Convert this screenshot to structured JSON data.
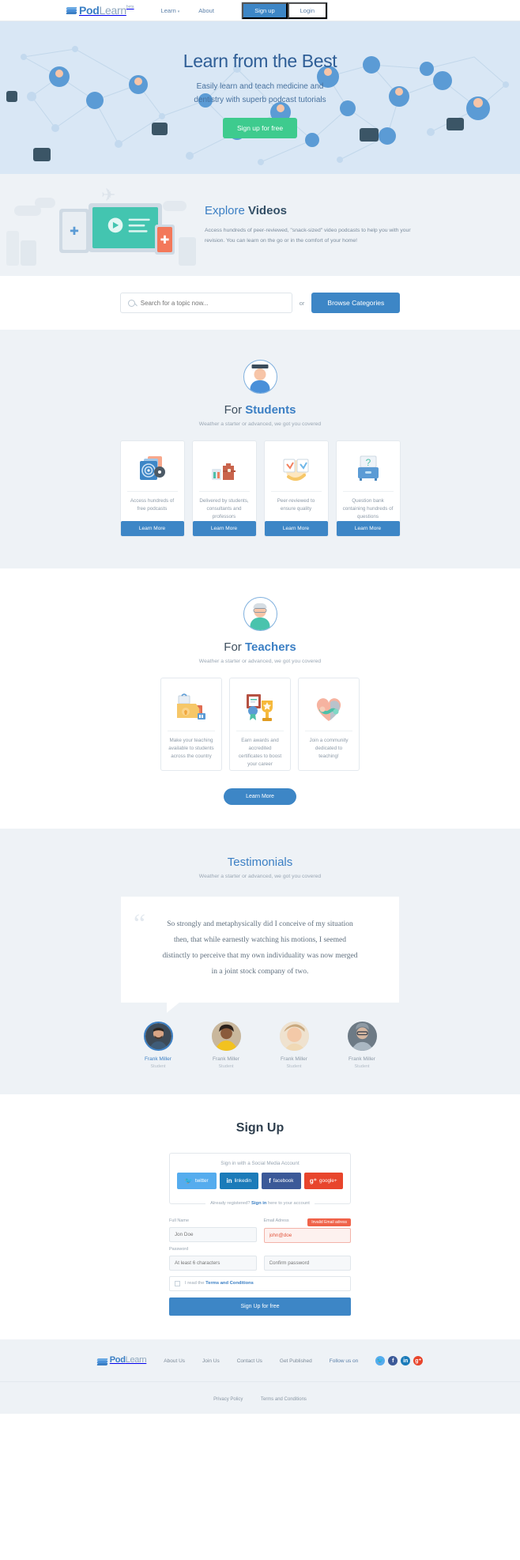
{
  "nav": {
    "brand": {
      "pod": "Pod",
      "learn": "Learn",
      "beta": "beta",
      "icon": "books-stack-icon"
    },
    "links": [
      {
        "label": "Learn",
        "has_caret": true
      },
      {
        "label": "About",
        "has_caret": false
      }
    ],
    "signup_label": "Sign up",
    "login_label": "Login"
  },
  "hero": {
    "title": "Learn from the Best",
    "subtitle_line1": "Easily learn and teach medicine and",
    "subtitle_line2": "dentistry with superb podcast tutorials",
    "cta_label": "Sign up for free",
    "cta_color": "#3ecb8e",
    "bg_color": "#d9e7f5"
  },
  "explore": {
    "heading_light": "Explore ",
    "heading_bold": "Videos",
    "paragraph": "Access hundreds of peer-reviewed, \"snack-sized\" video podcasts to help you with your revision. You can learn on the go or in the comfort of your home!",
    "bg_color": "#eef2f6"
  },
  "search": {
    "placeholder": "Search for a topic now...",
    "value": "",
    "icon": "search-icon",
    "or_label": "or",
    "browse_label": "Browse Categories"
  },
  "students": {
    "avatar_icon": "graduate-student-avatar",
    "heading_light": "For ",
    "heading_bold": "Students",
    "subtitle": "Weather a starter or advanced, we got you covered",
    "cards": [
      {
        "icon": "podcast-folder-icon",
        "text": "Access hundreds of free podcasts",
        "button": "Learn More"
      },
      {
        "icon": "briefcase-icon",
        "text": "Delivered by students, consultants and professors",
        "button": "Learn More"
      },
      {
        "icon": "peer-review-icon",
        "text": "Peer-reviewed to ensure quality",
        "button": "Learn More"
      },
      {
        "icon": "question-bank-icon",
        "text": "Question bank containing hundreds of questions",
        "button": "Learn More"
      }
    ]
  },
  "teachers": {
    "avatar_icon": "professor-avatar",
    "heading_light": "For ",
    "heading_bold": "Teachers",
    "subtitle": "Weather a starter or advanced, we got you covered",
    "cards": [
      {
        "icon": "teaching-materials-icon",
        "text": "Make your teaching available to students across the country"
      },
      {
        "icon": "award-trophy-icon",
        "text": "Earn awards and accredited certificates to boost your career"
      },
      {
        "icon": "community-heart-icon",
        "text": "Join a community dedicated to teaching!"
      }
    ],
    "cta_label": "Learn More"
  },
  "testimonials": {
    "heading": "Testimonials",
    "subtitle": "Weather a starter or advanced, we got you covered",
    "quote_mark": "“",
    "quote_lines": [
      "So strongly and metaphysically did I conceive of my situation",
      "then, that while earnestly watching his motions, I seemed",
      "distinctly to perceive that my own individuality was now merged",
      "in a joint stock company of two."
    ],
    "people": [
      {
        "name": "Frank Miller",
        "role": "Student",
        "active": true
      },
      {
        "name": "Frank Miller",
        "role": "Student",
        "active": false
      },
      {
        "name": "Frank Miller",
        "role": "Student",
        "active": false
      },
      {
        "name": "Frank Miller",
        "role": "Student",
        "active": false
      }
    ]
  },
  "signup": {
    "heading": "Sign Up",
    "social_label": "Sign in with a Social Media Account",
    "social_buttons": [
      {
        "label": "twitter",
        "glyph": "ᴠ",
        "color": "#55acee",
        "icon": "twitter-icon"
      },
      {
        "label": "linkedin",
        "glyph": "in",
        "color": "#1b7bb9",
        "icon": "linkedin-icon"
      },
      {
        "label": "facebook",
        "glyph": "f",
        "color": "#3b5998",
        "icon": "facebook-icon"
      },
      {
        "label": "google+",
        "glyph": "g+",
        "color": "#e8452c",
        "icon": "googleplus-icon"
      }
    ],
    "already_pre": "Already registered? ",
    "already_link": "Sign in",
    "already_post": " here to your account",
    "fields": {
      "fullname_label": "Full Name",
      "fullname_placeholder": "Jon Doe",
      "email_label": "Email Adress",
      "email_value": "john@doe",
      "email_error": "Invalid Email adress",
      "password_label": "Password",
      "password_placeholder": "At least 6 characters",
      "confirm_placeholder": "Confirm password"
    },
    "terms_pre": "I read the ",
    "terms_link": "Terms and Conditions",
    "submit_label": "Sign Up for free"
  },
  "footer": {
    "brand": {
      "pod": "Pod",
      "learn": "Learn"
    },
    "links": [
      "About Us",
      "Join Us",
      "Contact Us",
      "Get Published"
    ],
    "follow_label": "Follow us on",
    "socials": [
      {
        "glyph": "ᴠ",
        "color": "#55acee",
        "icon": "twitter-icon"
      },
      {
        "glyph": "f",
        "color": "#3b5998",
        "icon": "facebook-icon"
      },
      {
        "glyph": "in",
        "color": "#1b7bb9",
        "icon": "linkedin-icon"
      },
      {
        "glyph": "g+",
        "color": "#e8452c",
        "icon": "googleplus-icon"
      }
    ],
    "bottom_links": [
      "Privacy Policy",
      "Terms and Conditions"
    ]
  }
}
